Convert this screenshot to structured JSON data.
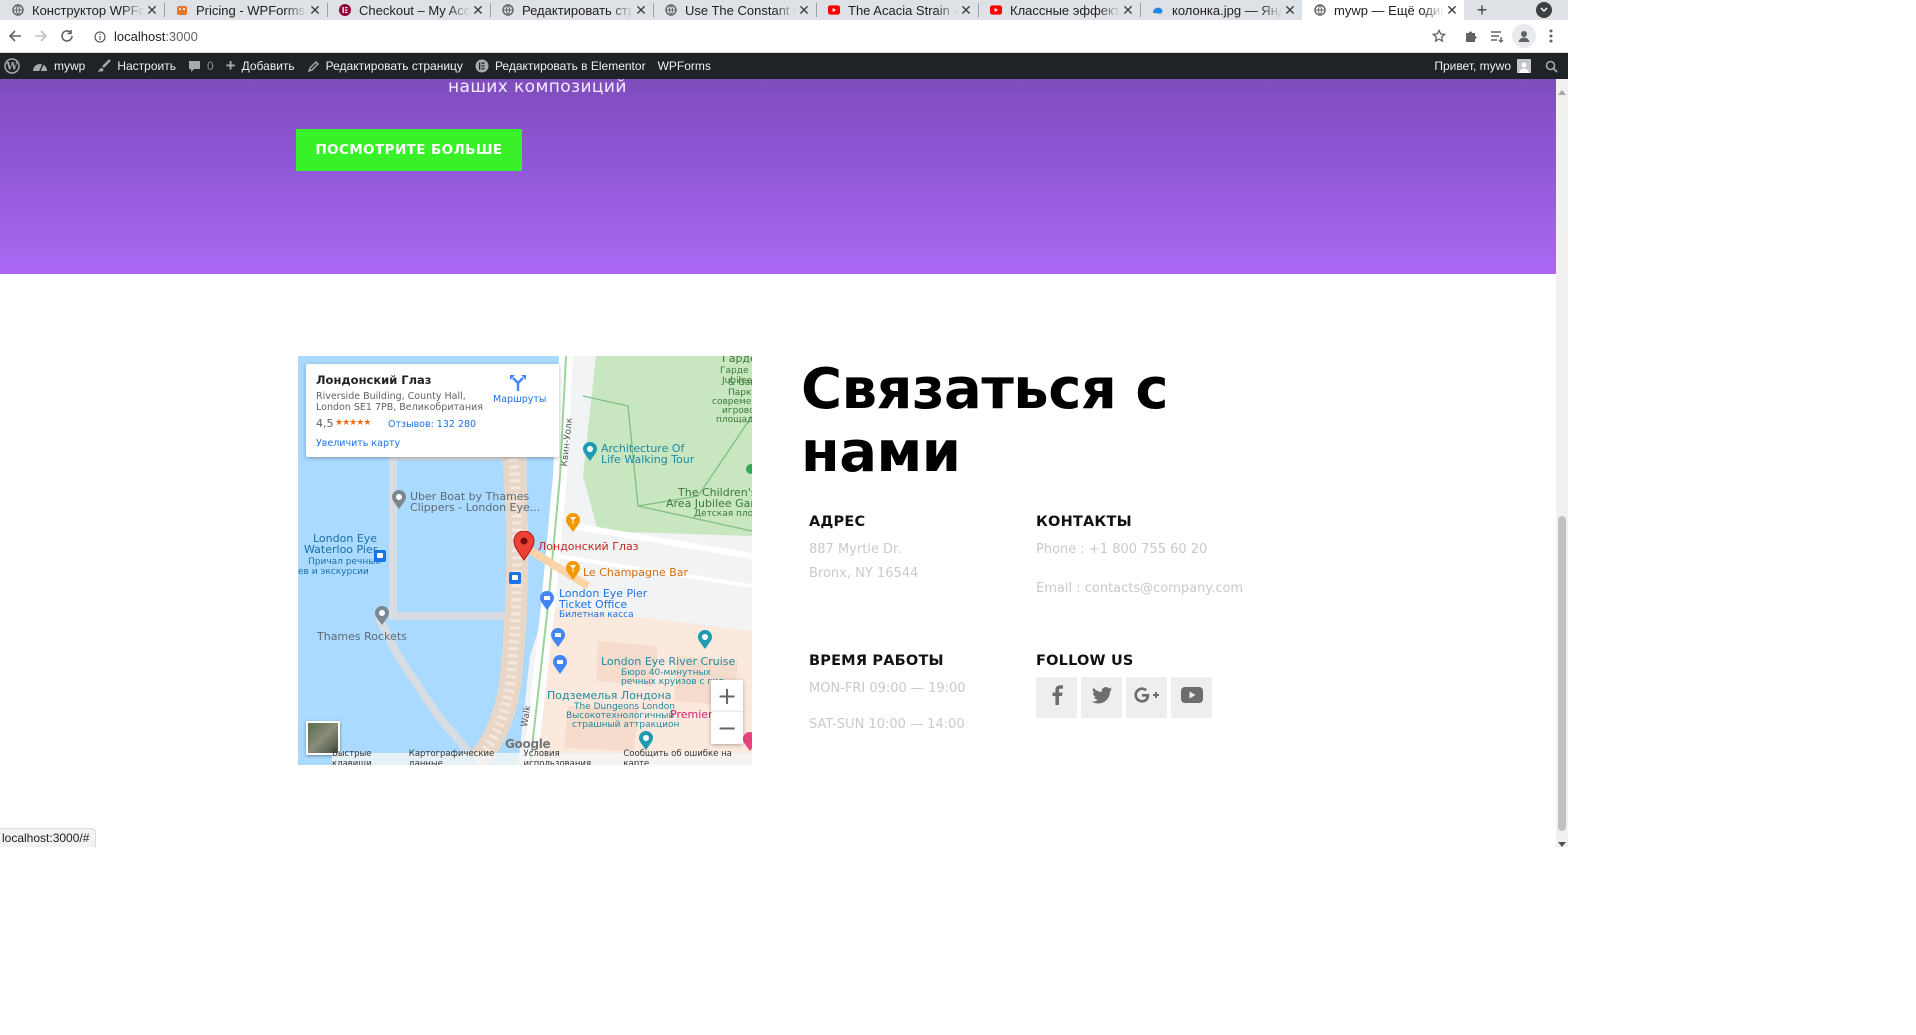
{
  "browser": {
    "tabs": [
      {
        "title": "Конструктор WPForms",
        "icon": "globe-icon",
        "color": "#5f6368"
      },
      {
        "title": "Pricing - WPForms",
        "icon": "wpforms-bear-icon",
        "color": "#e27730"
      },
      {
        "title": "Checkout – My Account",
        "icon": "elementor-icon",
        "color": "#92003b"
      },
      {
        "title": "Редактировать страницу",
        "icon": "globe-icon",
        "color": "#5f6368"
      },
      {
        "title": "Use The Constant Contact",
        "icon": "globe-icon",
        "color": "#5f6368"
      },
      {
        "title": "The Acacia Strain - Cold",
        "icon": "youtube-icon",
        "color": "#ff0000"
      },
      {
        "title": "Классные эффекты",
        "icon": "youtube-icon",
        "color": "#ff0000"
      },
      {
        "title": "колонка.jpg — Яндекс",
        "icon": "yandex-disk-icon",
        "color": "#1e88e5"
      },
      {
        "title": "mywp — Ещё один сайт",
        "icon": "globe-icon",
        "color": "#5f6368",
        "active": true
      }
    ],
    "url_host": "localhost",
    "url_port": ":3000",
    "status_url": "localhost:3000/#"
  },
  "adminbar": {
    "site": "mywp",
    "customize": "Настроить",
    "comments": "0",
    "add_new": "Добавить",
    "edit_page": "Редактировать страницу",
    "edit_elementor": "Редактировать в Elementor",
    "wpforms": "WPForms",
    "greeting": "Привет, mywo"
  },
  "hero": {
    "text": "наших композиций",
    "button": "ПОСМОТРИТЕ БОЛЬШЕ",
    "button_color": "#39f129"
  },
  "map": {
    "place_title": "Лондонский Глаз",
    "address_line1": "Riverside Building, County Hall,",
    "address_line2": "London SE1 7PB, Великобритания",
    "rating": "4,5",
    "stars": "★★★★★",
    "reviews": "Отзывов: 132 280",
    "enlarge": "Увеличить карту",
    "directions": "Маршруты",
    "labels": {
      "garden_top": "Гарде",
      "jubilee_park": "Jubilee P",
      "garden2": "& Garde",
      "park1": "Парк с",
      "park2": "современ",
      "park3": "игрово",
      "park4": "площадь",
      "queens_walk": "Квин-Уолк",
      "architecture": "Architecture Of",
      "architecture2": "Life Walking Tour",
      "childrens1": "The Children's",
      "childrens2": "Area Jubilee Garc",
      "childrens3": "Детская площ",
      "uber1": "Uber Boat by Thames",
      "uber2": "Clippers - London Eye...",
      "londoneye_pin": "Лондонский Глаз",
      "champagne": "Le Champagne Bar",
      "waterloo1": "London Eye",
      "waterloo2": "Waterloo Pier",
      "waterloo3": "Причал речных",
      "waterloo4": "ев и экскурсии",
      "pier1": "London Eye Pier",
      "pier2": "Ticket Office",
      "pier3": "Билетная касса",
      "thames_rockets": "Thames Rockets",
      "cruise1": "London Eye River Cruise",
      "cruise2": "Бюро 40-минутных",
      "cruise3": "речных круизов с гид",
      "dungeon1": "Подземелья Лондона",
      "dungeon2": "The Dungeons London",
      "dungeon3": "Высокотехнологичный",
      "dungeon4": "страшный аттракцион",
      "premier": "Premier",
      "walk": "Walk"
    },
    "google": "Google",
    "footer": [
      "Быстрые клавиши",
      "Картографические данные",
      "Условия использования",
      "Сообщить об ошибке на карте"
    ],
    "zoom_in": "+",
    "zoom_out": "−"
  },
  "contact": {
    "title_line1": "Связаться с",
    "title_line2": "нами",
    "address_h": "АДРЕС",
    "address1": "887 Myrtle Dr.",
    "address2": "Bronx, NY 16544",
    "contacts_h": "КОНТАКТЫ",
    "phone": "Phone : +1 800 755 60 20",
    "email": "Email : contacts@company.com",
    "hours_h": "ВРЕМЯ РАБОТЫ",
    "hours1": "MON-FRI 09:00 — 19:00",
    "hours2": "SAT-SUN 10:00 — 14:00",
    "follow_h": "FOLLOW US",
    "socials": [
      "facebook-icon",
      "twitter-icon",
      "google-plus-icon",
      "youtube-icon"
    ]
  }
}
